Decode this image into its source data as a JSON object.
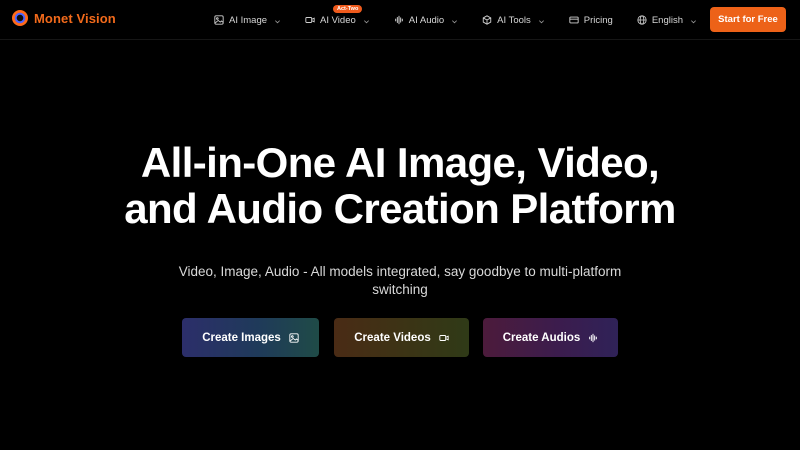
{
  "brand": {
    "name": "Monet Vision",
    "accent": "#f26a1b"
  },
  "nav": {
    "items": [
      {
        "label": "AI Image",
        "icon": "image-icon",
        "has_dropdown": true
      },
      {
        "label": "AI Video",
        "icon": "video-icon",
        "has_dropdown": true,
        "badge": "Act-Two"
      },
      {
        "label": "AI Audio",
        "icon": "audio-icon",
        "has_dropdown": true
      },
      {
        "label": "AI Tools",
        "icon": "cube-icon",
        "has_dropdown": true
      },
      {
        "label": "Pricing",
        "icon": "card-icon",
        "has_dropdown": false
      },
      {
        "label": "English",
        "icon": "globe-icon",
        "has_dropdown": true
      }
    ],
    "cta": "Start for Free",
    "cta_color": "#ed6218"
  },
  "hero": {
    "title_line1": "All-in-One AI Image, Video,",
    "title_line2": "and Audio Creation Platform",
    "subtitle": "Video, Image, Audio - All models integrated, say goodbye to multi-platform switching"
  },
  "actions": {
    "images": {
      "label": "Create Images",
      "icon": "image-icon"
    },
    "videos": {
      "label": "Create Videos",
      "icon": "video-icon"
    },
    "audios": {
      "label": "Create Audios",
      "icon": "audio-wave-icon"
    }
  }
}
